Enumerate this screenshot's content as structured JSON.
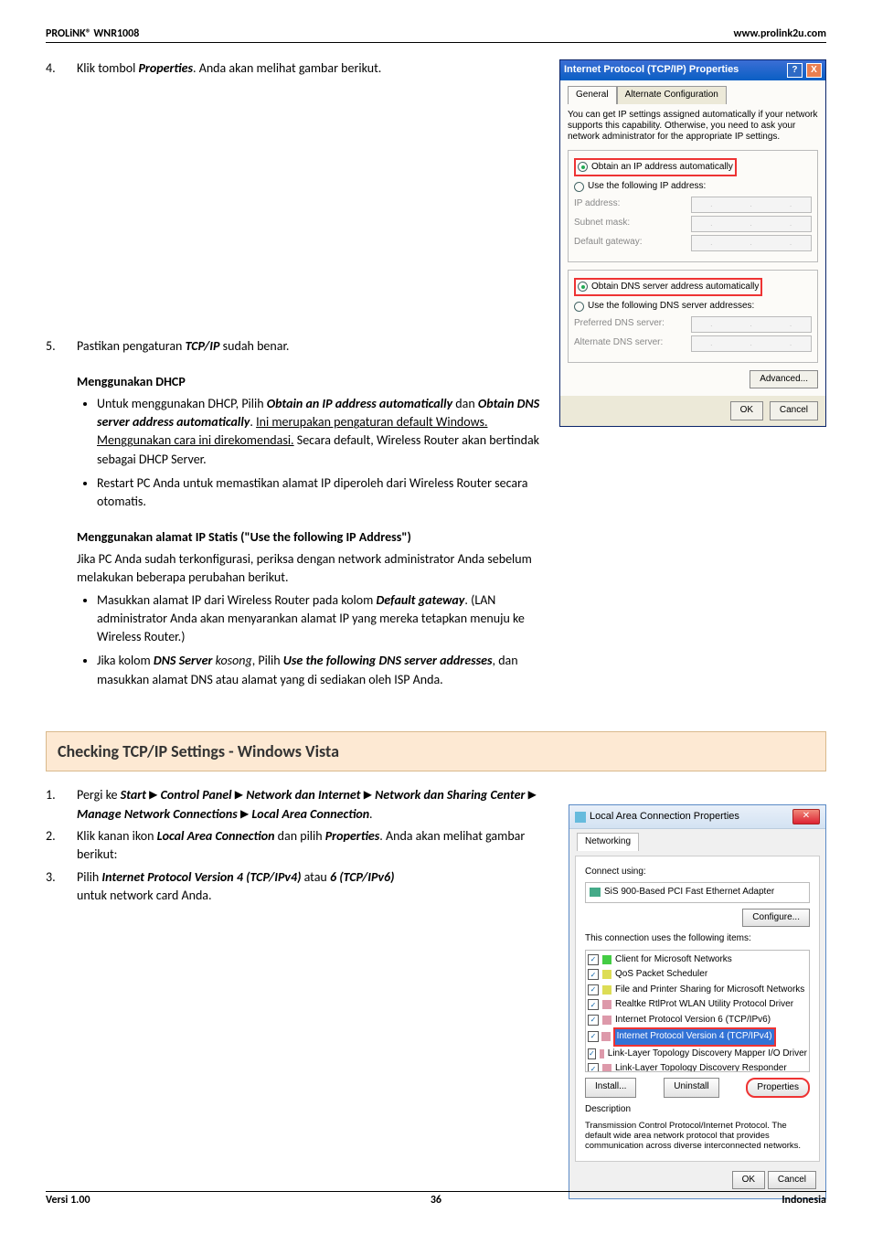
{
  "header": {
    "left": "PROLiNK® WNR1008",
    "right": "www.prolink2u.com"
  },
  "footer": {
    "left": "Versi 1.00",
    "center": "36",
    "right": "Indonesia"
  },
  "step4": {
    "num": "4.",
    "pre": "Klik tombol ",
    "bold": "Properties",
    "post": ". Anda akan melihat gambar berikut."
  },
  "xp": {
    "title": "Internet Protocol (TCP/IP) Properties",
    "tab_general": "General",
    "tab_alt": "Alternate Configuration",
    "desc": "You can get IP settings assigned automatically if your network supports this capability. Otherwise, you need to ask your network administrator for the appropriate IP settings.",
    "r_auto_ip": "Obtain an IP address automatically",
    "r_use_ip": "Use the following IP address:",
    "f_ip": "IP address:",
    "f_mask": "Subnet mask:",
    "f_gw": "Default gateway:",
    "r_auto_dns": "Obtain DNS server address automatically",
    "r_use_dns": "Use the following DNS server addresses:",
    "f_pdns": "Preferred DNS server:",
    "f_adns": "Alternate DNS server:",
    "btn_adv": "Advanced...",
    "btn_ok": "OK",
    "btn_cancel": "Cancel"
  },
  "step5": {
    "num": "5.",
    "t1": "Pastikan pengaturan ",
    "t1b": "TCP/IP",
    "t1c": " sudah benar.",
    "heading_dhcp": "Menggunakan DHCP",
    "dhcp_b1_a": "Untuk menggunakan DHCP, Pilih  ",
    "dhcp_b1_b": "Obtain an IP address automatically",
    "dhcp_b1_c": " dan ",
    "dhcp_b1_d": "Obtain DNS server address automatically",
    "dhcp_b1_e": ". ",
    "dhcp_b1_f": "Ini merupakan pengaturan default Windows. Menggunakan cara ini direkomendasi.",
    "dhcp_b1_g": " Secara default, Wireless Router akan bertindak sebagai DHCP Server.",
    "dhcp_b2": "Restart PC Anda untuk memastikan alamat IP diperoleh dari Wireless Router secara otomatis.",
    "heading_static": "Menggunakan alamat IP Statis (\"Use the following IP Address\")",
    "static_intro": "Jika PC Anda sudah terkonfigurasi, periksa dengan network administrator Anda sebelum melakukan beberapa perubahan berikut.",
    "static_b1_a": "Masukkan alamat IP dari Wireless Router pada kolom ",
    "static_b1_b": "Default gateway",
    "static_b1_c": ". (LAN administrator Anda akan menyarankan alamat IP yang mereka tetapkan menuju ke Wireless Router.)",
    "static_b2_a": "Jika kolom ",
    "static_b2_b": "DNS Server",
    "static_b2_c": " kosong",
    "static_b2_d": ", Pilih  ",
    "static_b2_e": "Use the following DNS server addresses",
    "static_b2_f": ", dan masukkan alamat DNS atau alamat yang di sediakan oleh ISP Anda."
  },
  "section_vista": "Checking TCP/IP Settings - Windows Vista",
  "vista_steps": {
    "s1": {
      "num": "1.",
      "a": "Pergi ke ",
      "p1": "Start",
      "p2": "Control Panel",
      "p3": "Network dan Internet",
      "p4": "Network dan Sharing Center",
      "p5": "Manage Network Connections",
      "p6": "Local Area Connection",
      "dot": "."
    },
    "s2": {
      "num": "2.",
      "a": "Klik kanan ikon ",
      "b": "Local Area Connection",
      "c": " dan pilih ",
      "d": "Properties",
      "e": ". Anda akan melihat gambar berikut:"
    },
    "s3": {
      "num": "3.",
      "a": "Pilih  ",
      "b": "Internet Protocol Version 4 (TCP/IPv4)",
      "c": " atau ",
      "d": "6 (TCP/IPv6)",
      "e": " untuk network card Anda."
    }
  },
  "vista": {
    "title": "Local Area Connection Properties",
    "tab": "Networking",
    "connect_using": "Connect using:",
    "adapter": "SiS 900-Based PCI Fast Ethernet Adapter",
    "btn_configure": "Configure...",
    "conn_items_lbl": "This connection uses the following items:",
    "items": [
      "Client for Microsoft Networks",
      "QoS Packet Scheduler",
      "File and Printer Sharing for Microsoft Networks",
      "Realtke RtlProt WLAN Utility Protocol Driver",
      "Internet Protocol Version 6 (TCP/IPv6)",
      "Internet Protocol Version 4 (TCP/IPv4)",
      "Link-Layer Topology Discovery Mapper I/O Driver",
      "Link-Layer Topology Discovery Responder"
    ],
    "btn_install": "Install...",
    "btn_uninstall": "Uninstall",
    "btn_properties": "Properties",
    "desc_hdr": "Description",
    "desc_body": "Transmission Control Protocol/Internet Protocol. The default wide area network protocol that provides communication across diverse interconnected networks.",
    "btn_ok": "OK",
    "btn_cancel": "Cancel"
  }
}
